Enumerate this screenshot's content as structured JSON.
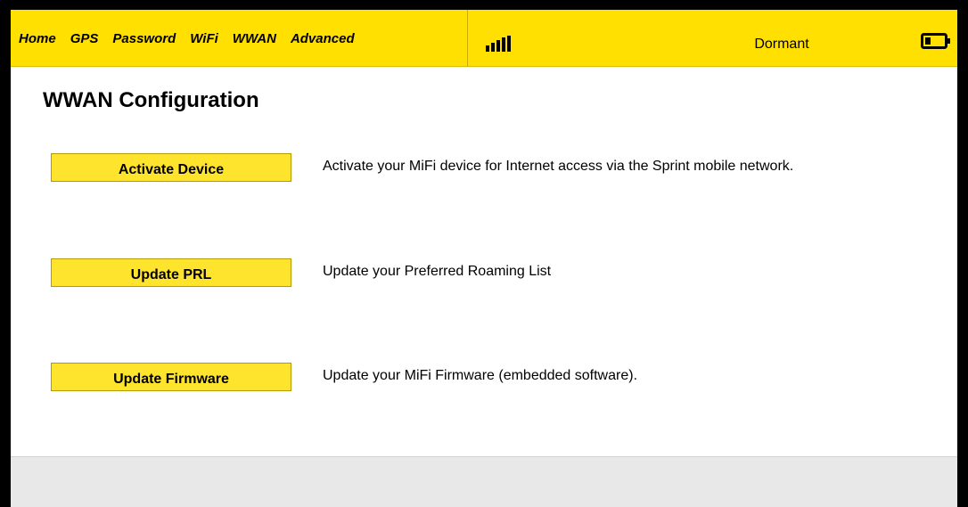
{
  "nav": {
    "items": [
      {
        "label": "Home"
      },
      {
        "label": "GPS"
      },
      {
        "label": "Password"
      },
      {
        "label": "WiFi"
      },
      {
        "label": "WWAN"
      },
      {
        "label": "Advanced"
      }
    ]
  },
  "status_bar": {
    "signal_icon": "signal-strength-icon",
    "connection_status": "Dormant",
    "battery_icon": "battery-icon"
  },
  "page": {
    "title": "WWAN Configuration"
  },
  "actions": [
    {
      "button_label": "Activate Device",
      "description": "Activate your MiFi device for Internet access via the Sprint mobile network."
    },
    {
      "button_label": "Update PRL",
      "description": "Update your Preferred Roaming List"
    },
    {
      "button_label": "Update Firmware",
      "description": "Update your MiFi Firmware (embedded software)."
    }
  ],
  "colors": {
    "brand_yellow": "#ffe000",
    "button_yellow": "#ffe42e",
    "text": "#000000",
    "footer": "#e8e8e8"
  }
}
